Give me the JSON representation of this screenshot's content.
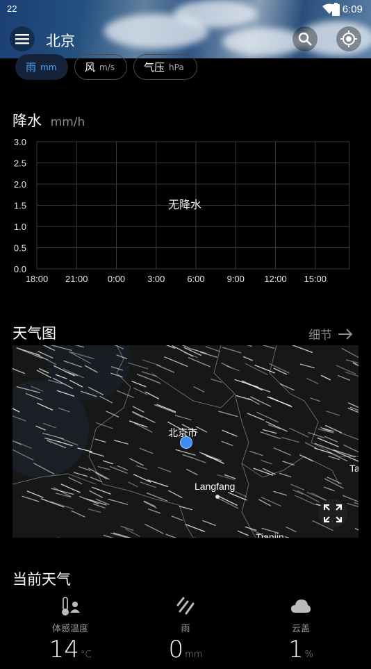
{
  "status": {
    "left": "22",
    "time": "6:09"
  },
  "appbar": {
    "city": "北京"
  },
  "chips": [
    {
      "label": "雨",
      "unit": "mm"
    },
    {
      "label": "风",
      "unit": "m/s"
    },
    {
      "label": "气压",
      "unit": "hPa"
    }
  ],
  "precip": {
    "title": "降水",
    "unit": "mm/h",
    "empty_message": "无降水"
  },
  "chart_data": {
    "type": "line",
    "title": "降水",
    "ylabel": "mm/h",
    "x": [
      "18:00",
      "21:00",
      "0:00",
      "3:00",
      "6:00",
      "9:00",
      "12:00",
      "15:00"
    ],
    "y_ticks": [
      "3.0",
      "2.5",
      "2.0",
      "1.5",
      "1.0",
      "0.5",
      "0.0"
    ],
    "ylim": [
      0,
      3.0
    ],
    "series": [
      {
        "values": [
          0,
          0,
          0,
          0,
          0,
          0,
          0,
          0
        ]
      }
    ],
    "grid": true,
    "annotation": "无降水"
  },
  "weather_map": {
    "title": "天气图",
    "details_label": "细节",
    "labels": {
      "beijing": "北京市",
      "langfang": "Langfang",
      "edge_right": "Ta",
      "edge_bottom": "Tianjin"
    }
  },
  "current": {
    "title": "当前天气",
    "metrics": [
      {
        "icon": "thermometer-person-icon",
        "label": "体感温度",
        "value": "14",
        "unit": "°C"
      },
      {
        "icon": "rain-icon",
        "label": "雨",
        "value": "0",
        "unit": "mm"
      },
      {
        "icon": "cloud-icon",
        "label": "云盖",
        "value": "1",
        "unit": "%"
      }
    ]
  }
}
